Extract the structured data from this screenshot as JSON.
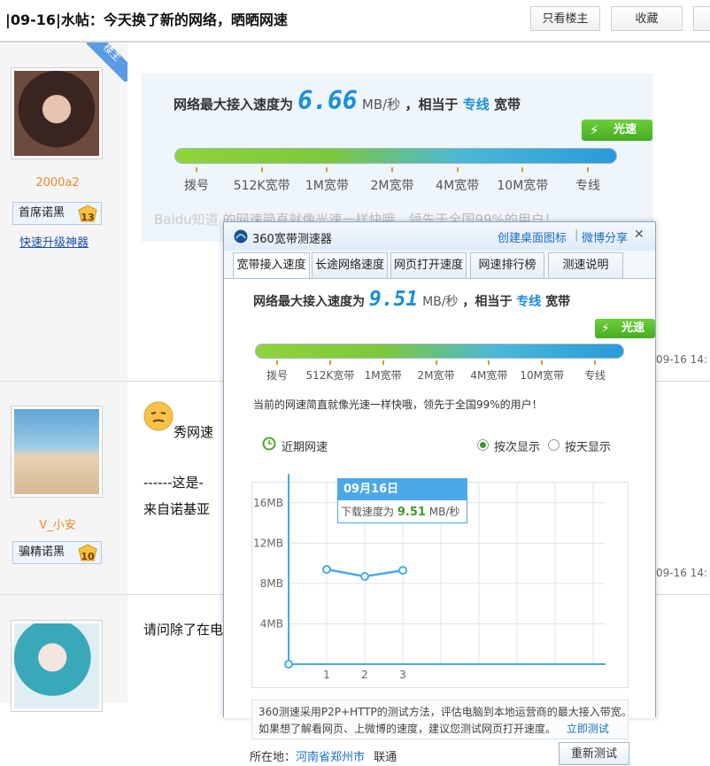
{
  "thread": {
    "title": "|09-16|水帖：今天换了新的网络，晒晒网速",
    "only_op_label": "只看楼主",
    "favorite_label": "收藏"
  },
  "posts": [
    {
      "op_badge": "楼主",
      "username": "2000a2",
      "rank_title": "首席诺黑",
      "level": "13",
      "upgrade_link": "快速升级神器",
      "timestamp": "09-16 14:"
    },
    {
      "username": "V_小安",
      "rank_title": "骗精诺黑",
      "level": "10",
      "text_1": "秀网速",
      "text_2": "------这是-",
      "text_3": "来自诺基亚",
      "timestamp": "09-16 14:"
    },
    {
      "text_1": "请问除了在电"
    }
  ],
  "post_image": {
    "title_prefix": "网络最大接入速度为",
    "speed": "6.66",
    "unit": "MB/秒",
    "middle": "，相当于",
    "line_type": "专线",
    "suffix": "宽带",
    "badge": "光速",
    "watermark": "Baidu知道",
    "fragment_1": "当前",
    "fragment_2": "的网速简直就像光速一样快哦，领先于全国99%的用户！"
  },
  "scale_labels": [
    "拨号",
    "512K宽带",
    "1M宽带",
    "2M宽带",
    "4M宽带",
    "10M宽带",
    "专线"
  ],
  "dialog": {
    "title": "360宽带测速器",
    "create_shortcut": "创建桌面图标",
    "divider": "|",
    "weibo_share": "微博分享",
    "close": "✕",
    "tabs": [
      "宽带接入速度",
      "长途网络速度",
      "网页打开速度",
      "网速排行榜",
      "测速说明"
    ],
    "title_prefix": "网络最大接入速度为",
    "speed": "9.51",
    "unit": "MB/秒",
    "middle": "，相当于",
    "line_type": "专线",
    "suffix": "宽带",
    "badge": "光速",
    "summary": "当前的网速简直就像光速一样快哦，领先于全国99%的用户！",
    "recent_label": "近期网速",
    "by_count": "按次显示",
    "by_day": "按天显示",
    "note_line1": "360测速采用P2P+HTTP的测试方法，评估电脑到本地运营商的最大接入带宽。",
    "note_line2": "如果想了解看网页、上微博的速度，建议您测试网页打开速度。",
    "test_now": "立即测试",
    "location_label": "所在地：",
    "location": "河南省郑州市",
    "isp": "联通",
    "retest": "重新测试"
  },
  "colors": {
    "accent_blue": "#1a8fd8",
    "badge_green": "#4cb52a",
    "username_orange": "#f08a24"
  },
  "chart_data": {
    "type": "line",
    "x": [
      1,
      2,
      3
    ],
    "xtick_labels": [
      "1",
      "2",
      "3"
    ],
    "values": [
      9.4,
      8.7,
      9.3
    ],
    "ylim": [
      0,
      18
    ],
    "ytick_values": [
      4,
      8,
      12,
      16
    ],
    "ytick_labels": [
      "4MB",
      "8MB",
      "12MB",
      "16MB"
    ],
    "grid": true,
    "tooltip": {
      "date": "09月16日",
      "label": "下载速度为",
      "value": "9.51",
      "unit": "MB/秒"
    }
  }
}
